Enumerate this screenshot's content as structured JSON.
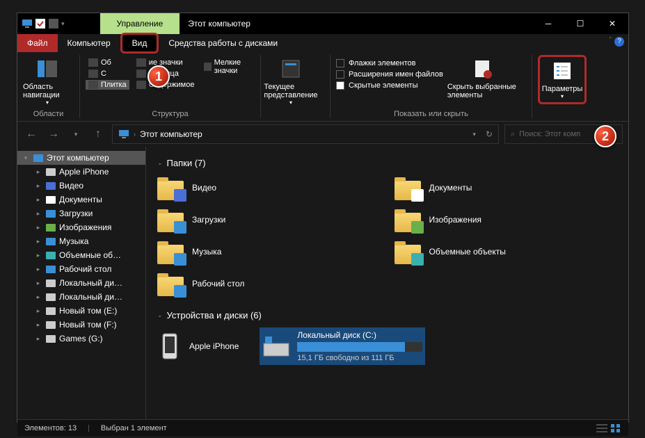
{
  "titlebar": {
    "contextTab": "Управление",
    "title": "Этот компьютер"
  },
  "menu": {
    "file": "Файл",
    "computer": "Компьютер",
    "view": "Вид",
    "tools": "Средства работы с дисками"
  },
  "ribbon": {
    "navPane": "Область навигации",
    "navGroup": "Области",
    "layouts": {
      "col1": [
        "Об",
        "С",
        "Плитка"
      ],
      "col2": [
        "ие значки",
        "Таблица",
        "Содержимое"
      ],
      "col3": [
        "Мелкие значки"
      ]
    },
    "layoutGroup": "Структура",
    "currentView": "Текущее представление",
    "chk1": "Флажки элементов",
    "chk2": "Расширения имен файлов",
    "chk3": "Скрытые элементы",
    "hideSelected": "Скрыть выбранные элементы",
    "showHideGroup": "Показать или скрыть",
    "params": "Параметры"
  },
  "address": {
    "path": "Этот компьютер",
    "searchPlaceholder": "Поиск: Этот комп",
    "refresh": "↻"
  },
  "tree": [
    {
      "label": "Этот компьютер",
      "icon": "pc",
      "indent": 0,
      "sel": true,
      "chev": "▾"
    },
    {
      "label": "Apple iPhone",
      "icon": "phone",
      "indent": 1,
      "chev": "▸"
    },
    {
      "label": "Видео",
      "icon": "video",
      "indent": 1,
      "chev": "▸"
    },
    {
      "label": "Документы",
      "icon": "doc",
      "indent": 1,
      "chev": "▸"
    },
    {
      "label": "Загрузки",
      "icon": "download",
      "indent": 1,
      "chev": "▸"
    },
    {
      "label": "Изображения",
      "icon": "img",
      "indent": 1,
      "chev": "▸"
    },
    {
      "label": "Музыка",
      "icon": "music",
      "indent": 1,
      "chev": "▸"
    },
    {
      "label": "Объемные об…",
      "icon": "3d",
      "indent": 1,
      "chev": "▸"
    },
    {
      "label": "Рабочий стол",
      "icon": "desktop",
      "indent": 1,
      "chev": "▸"
    },
    {
      "label": "Локальный ди…",
      "icon": "drive",
      "indent": 1,
      "chev": "▸"
    },
    {
      "label": "Локальный ди…",
      "icon": "drive",
      "indent": 1,
      "chev": "▸"
    },
    {
      "label": "Новый том (E:)",
      "icon": "drive",
      "indent": 1,
      "chev": "▸"
    },
    {
      "label": "Новый том (F:)",
      "icon": "drive",
      "indent": 1,
      "chev": "▸"
    },
    {
      "label": "Games (G:)",
      "icon": "drive",
      "indent": 1,
      "chev": "▸"
    }
  ],
  "content": {
    "foldersTitle": "Папки (7)",
    "folders": [
      {
        "label": "Видео",
        "sub": "video"
      },
      {
        "label": "Документы",
        "sub": "doc"
      },
      {
        "label": "Загрузки",
        "sub": "download"
      },
      {
        "label": "Изображения",
        "sub": "img"
      },
      {
        "label": "Музыка",
        "sub": "music"
      },
      {
        "label": "Объемные объекты",
        "sub": "3d"
      },
      {
        "label": "Рабочий стол",
        "sub": "desktop"
      }
    ],
    "devicesTitle": "Устройства и диски (6)",
    "iphone": "Apple iPhone",
    "drive": {
      "label": "Локальный диск (C:)",
      "sub": "15,1 ГБ свободно из 111 ГБ",
      "pct": 86
    }
  },
  "status": {
    "items": "Элементов: 13",
    "selected": "Выбран 1 элемент"
  },
  "badges": {
    "b1": "1",
    "b2": "2"
  }
}
